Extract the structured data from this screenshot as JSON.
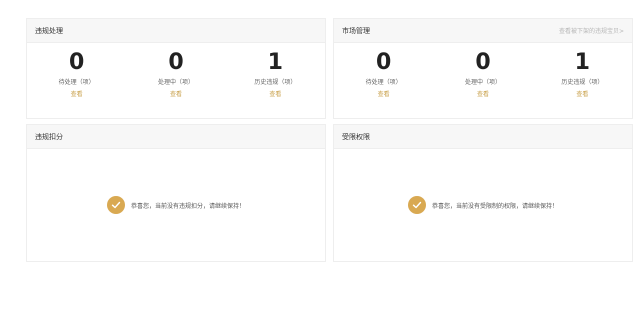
{
  "violation_handling": {
    "title": "违规处理",
    "stats": [
      {
        "value": "0",
        "label": "待处理（项）",
        "action": "查看"
      },
      {
        "value": "0",
        "label": "处理中（项）",
        "action": "查看"
      },
      {
        "value": "1",
        "label": "历史违规（项）",
        "action": "查看"
      }
    ]
  },
  "market_management": {
    "title": "市场管理",
    "link": "查看被下架的违规宝贝>",
    "stats": [
      {
        "value": "0",
        "label": "待处理（项）",
        "action": "查看"
      },
      {
        "value": "0",
        "label": "处理中（项）",
        "action": "查看"
      },
      {
        "value": "1",
        "label": "历史违规（项）",
        "action": "查看"
      }
    ]
  },
  "violation_points": {
    "title": "违规扣分",
    "message": "恭喜您，当前没有违规扣分，请继续保持！",
    "icon": "check-circle-icon",
    "icon_color": "#d9a952"
  },
  "restricted_permissions": {
    "title": "受限权限",
    "message": "恭喜您，当前没有受限制的权限，请继续保持！",
    "icon": "check-circle-icon",
    "icon_color": "#d9a952"
  }
}
